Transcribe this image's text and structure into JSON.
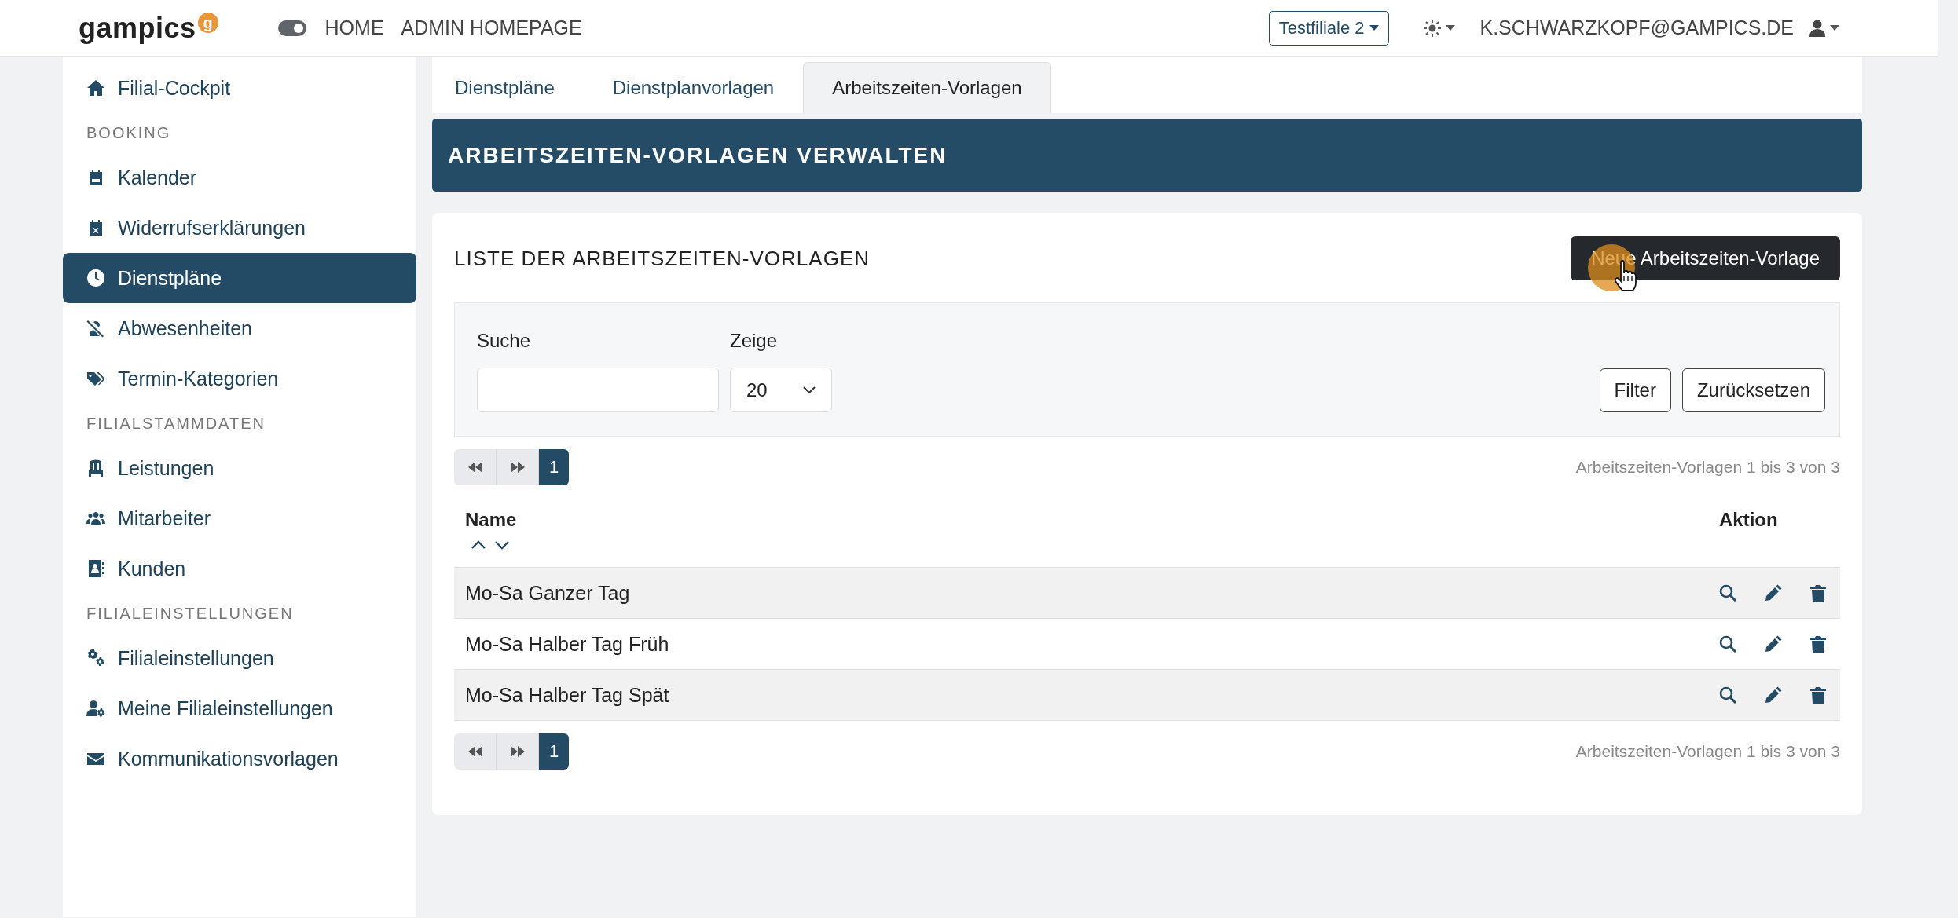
{
  "header": {
    "logo": "gampics",
    "logo_badge": "g",
    "mode_toggle": {
      "on": true
    },
    "nav": [
      {
        "label": "HOME"
      },
      {
        "label": "ADMIN HOMEPAGE"
      }
    ],
    "branch_select": "Testfiliale 2",
    "user": "K.SCHWARZKOPF@GAMPICS.DE"
  },
  "sidebar": {
    "items": [
      {
        "kind": "link",
        "label": "Filial-Cockpit",
        "selected": false
      },
      {
        "kind": "heading",
        "label": "BOOKING"
      },
      {
        "kind": "link",
        "label": "Kalender",
        "selected": false
      },
      {
        "kind": "link",
        "label": "Widerrufserklärungen",
        "selected": false
      },
      {
        "kind": "link",
        "label": "Dienstpläne",
        "selected": true
      },
      {
        "kind": "link",
        "label": "Abwesenheiten",
        "selected": false
      },
      {
        "kind": "link",
        "label": "Termin-Kategorien",
        "selected": false
      },
      {
        "kind": "heading",
        "label": "FILIALSTAMMDATEN"
      },
      {
        "kind": "link",
        "label": "Leistungen",
        "selected": false
      },
      {
        "kind": "link",
        "label": "Mitarbeiter",
        "selected": false
      },
      {
        "kind": "link",
        "label": "Kunden",
        "selected": false
      },
      {
        "kind": "heading",
        "label": "FILIALEINSTELLUNGEN"
      },
      {
        "kind": "link",
        "label": "Filialeinstellungen",
        "selected": false
      },
      {
        "kind": "link",
        "label": "Meine Filialeinstellungen",
        "selected": false
      },
      {
        "kind": "link",
        "label": "Kommunikationsvorlagen",
        "selected": false
      }
    ]
  },
  "tabs": [
    {
      "label": "Dienstpläne",
      "selected": false
    },
    {
      "label": "Dienstplanvorlagen",
      "selected": false
    },
    {
      "label": "Arbeitszeiten-Vorlagen",
      "selected": true
    }
  ],
  "banner": {
    "title": "ARBEITSZEITEN-VORLAGEN VERWALTEN"
  },
  "card": {
    "title": "LISTE DER ARBEITSZEITEN-VORLAGEN",
    "new_button": "Neue Arbeitszeiten-Vorlage",
    "filter": {
      "search_label": "Suche",
      "show_label": "Zeige",
      "show_value": "20",
      "buttons": [
        "Filter",
        "Zurücksetzen"
      ]
    },
    "pagination_top": {
      "pages": [
        {
          "label": "1",
          "selected": true
        }
      ],
      "summary": "Arbeitszeiten-Vorlagen 1 bis 3 von 3"
    },
    "table": {
      "columns": [
        "Name",
        "Aktion"
      ],
      "rows": [
        {
          "name": "Mo-Sa Ganzer Tag"
        },
        {
          "name": "Mo-Sa Halber Tag Früh"
        },
        {
          "name": "Mo-Sa Halber Tag Spät"
        }
      ]
    },
    "pagination_bottom": {
      "pages": [
        {
          "label": "1",
          "selected": true
        }
      ],
      "summary": "Arbeitszeiten-Vorlagen 1 bis 3 von 3"
    }
  }
}
